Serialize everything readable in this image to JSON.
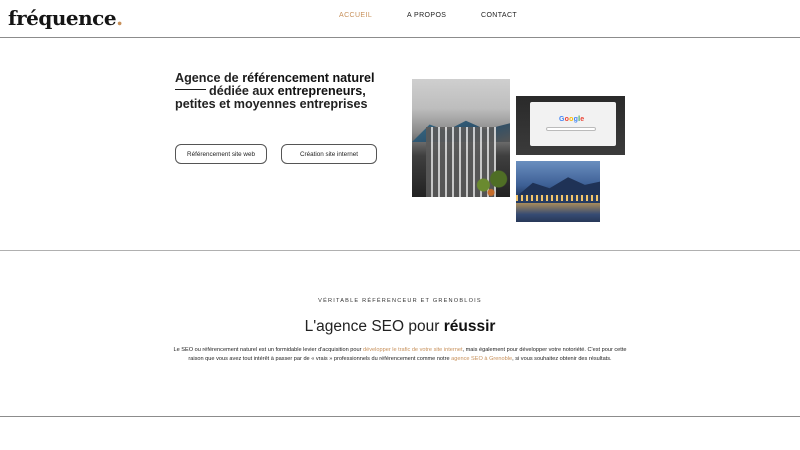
{
  "brand": {
    "logo_text": "fréquence",
    "logo_dot": ".",
    "accent_color": "#c7905a"
  },
  "nav": {
    "items": [
      {
        "label": "ACCUEIL",
        "active": true
      },
      {
        "label": "A PROPOS",
        "active": false
      },
      {
        "label": "CONTACT",
        "active": false
      }
    ]
  },
  "hero": {
    "title_line1_prefix": "Agence de ",
    "title_line1_bold": "référencement naturel",
    "title_line2_prefix": "dédiée aux ",
    "title_line2_bold": "entrepreneurs,",
    "title_line3": "petites et moyennes entreprises",
    "buttons": [
      {
        "label": "Référencement site web"
      },
      {
        "label": "Création site internet"
      }
    ],
    "photos": {
      "google_word": [
        "G",
        "o",
        "o",
        "g",
        "l",
        "e"
      ]
    }
  },
  "about": {
    "eyebrow": "VÉRITABLE RÉFÉRENCEUR ET GRENOBLOIS",
    "title_prefix": "L'agence SEO pour ",
    "title_bold": "réussir",
    "para_part1": "Le SEO ou référencement naturel est un formidable levier d'acquisition pour ",
    "para_link1": "développer le trafic de votre site internet",
    "para_part2": ", mais également pour développer votre notoriété. C'est pour cette raison que vous avez tout intérêt à passer par de « vrais » professionnels du référencement comme notre ",
    "para_link2": "agence SEO à Grenoble",
    "para_part3": ", si vous souhaitez obtenir des résultats."
  }
}
